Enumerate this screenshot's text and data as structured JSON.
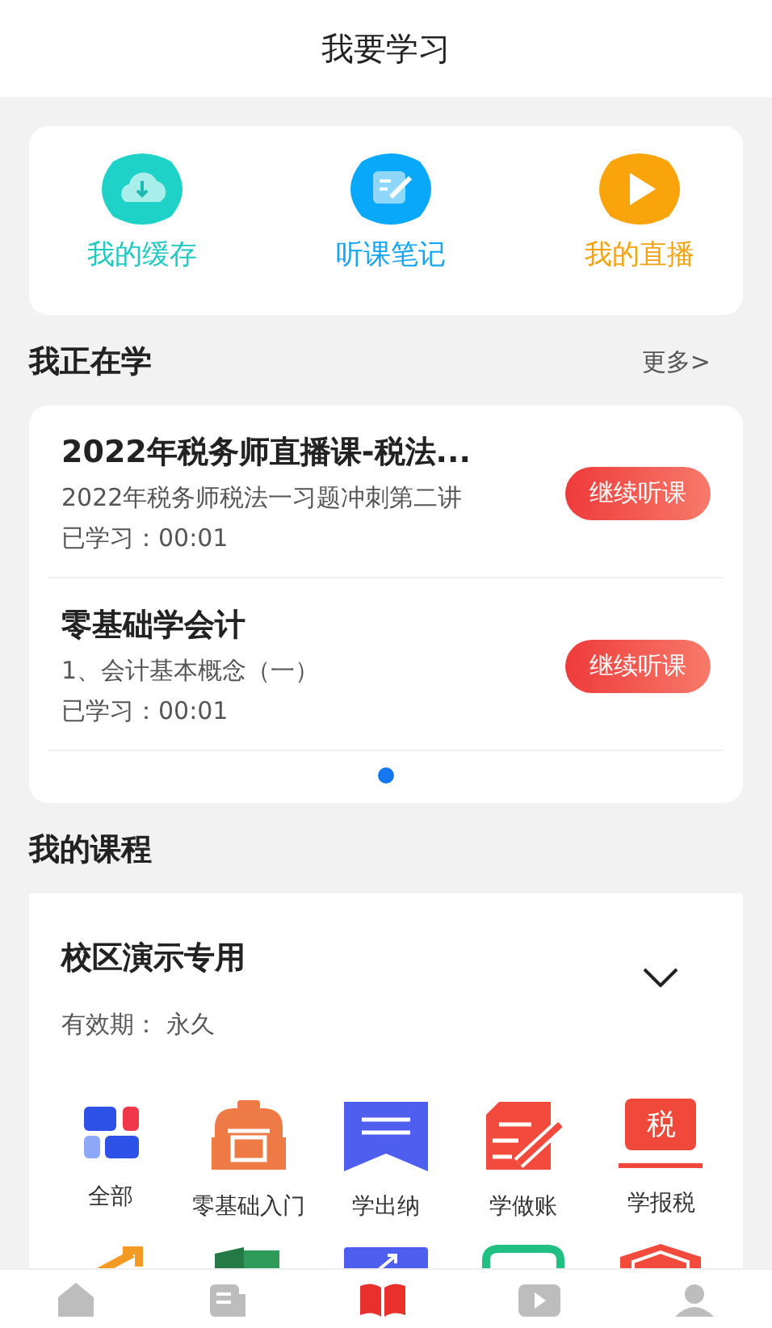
{
  "header": {
    "title": "我要学习"
  },
  "shortcuts": [
    {
      "label": "我的缓存",
      "kind": "cloud",
      "color": "#1fc9c2"
    },
    {
      "label": "听课笔记",
      "kind": "note",
      "color": "#12a5f5"
    },
    {
      "label": "我的直播",
      "kind": "play",
      "color": "#f5a20f"
    }
  ],
  "learning": {
    "title": "我正在学",
    "more": "更多>",
    "items": [
      {
        "title": "2022年税务师直播课-税法...",
        "lesson": "2022年税务师税法一习题冲刺第二讲",
        "progress": "已学习：00:01",
        "button": "继续听课"
      },
      {
        "title": "零基础学会计",
        "lesson": "1、会计基本概念（一）",
        "progress": "已学习：00:01",
        "button": "继续听课"
      }
    ],
    "pager": [
      {
        "selected": true
      }
    ]
  },
  "courses": {
    "title": "我的课程",
    "name": "校区演示专用",
    "validity": "有效期：  永久",
    "expanded": false,
    "categories": [
      {
        "label": "全部",
        "kind": "grid"
      },
      {
        "label": "零基础入门",
        "kind": "bag"
      },
      {
        "label": "学出纳",
        "kind": "ribbon"
      },
      {
        "label": "学做账",
        "kind": "doc"
      },
      {
        "label": "学报税",
        "kind": "tax",
        "glyph": "税"
      }
    ],
    "more_categories": [
      {
        "kind": "arrow"
      },
      {
        "kind": "flag"
      },
      {
        "kind": "chart"
      },
      {
        "kind": "tray"
      },
      {
        "kind": "shield"
      }
    ]
  },
  "nav": [
    {
      "kind": "home",
      "selected": false
    },
    {
      "kind": "doc",
      "selected": false
    },
    {
      "kind": "book",
      "selected": true
    },
    {
      "kind": "video",
      "selected": false
    },
    {
      "kind": "user",
      "selected": false
    }
  ]
}
